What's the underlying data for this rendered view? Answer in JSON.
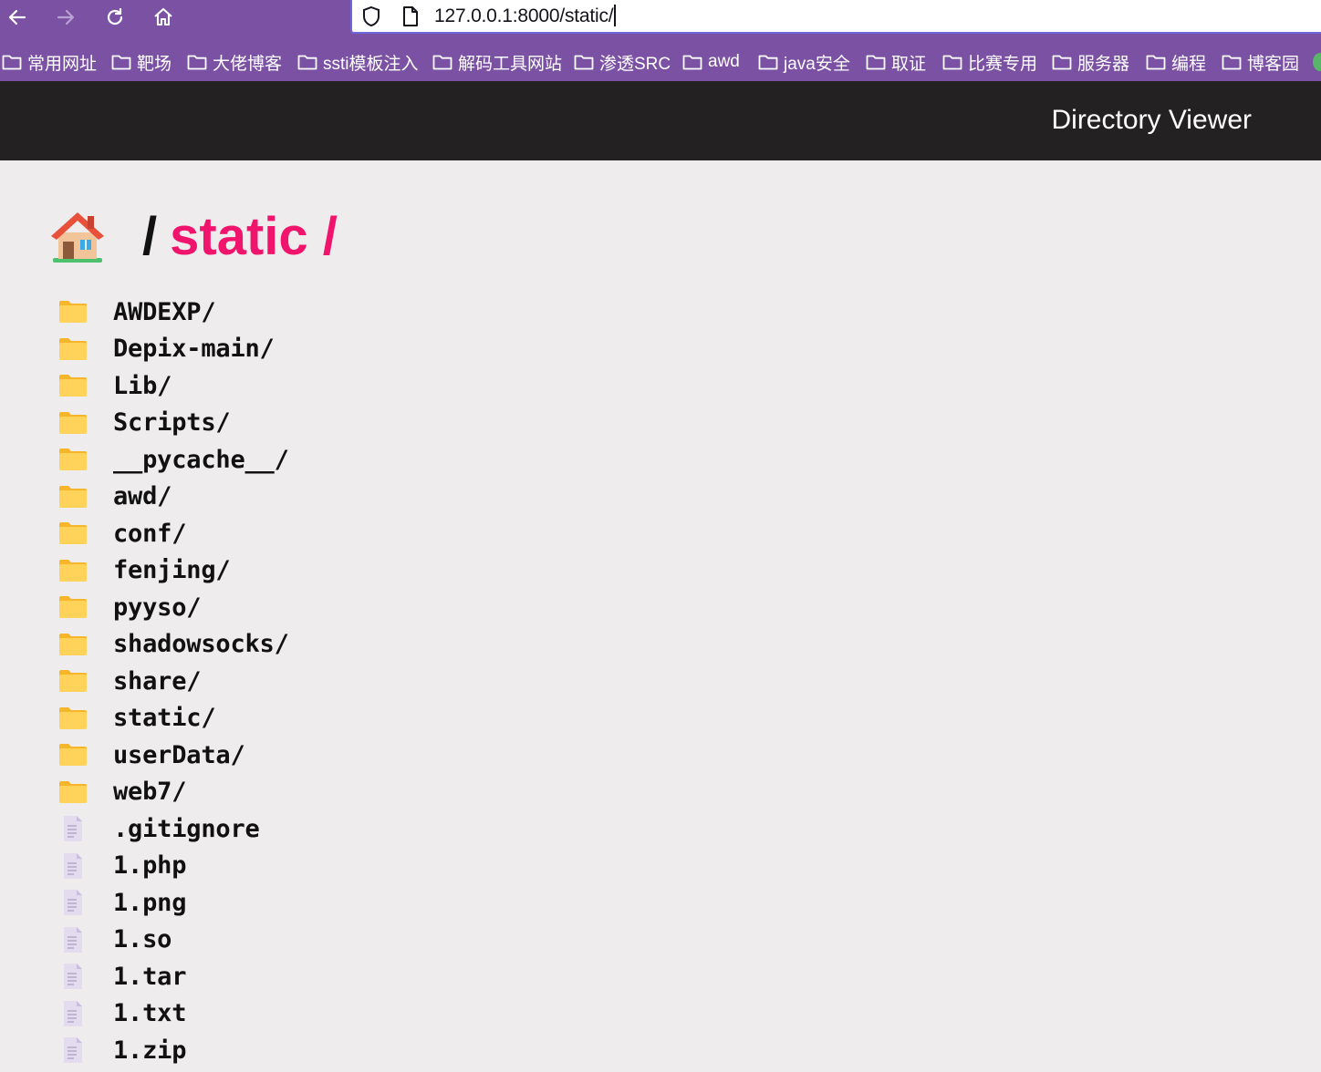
{
  "browser": {
    "url": "127.0.0.1:8000/static/",
    "nav": {
      "back_icon": "arrow-left-icon",
      "forward_icon": "arrow-right-icon",
      "reload_icon": "reload-icon",
      "home_icon": "home-icon"
    },
    "bookmarks": [
      "常用网址",
      "靶场",
      "大佬博客",
      "ssti模板注入",
      "解码工具网站",
      "渗透SRC",
      "awd",
      "java安全",
      "取证",
      "比赛专用",
      "服务器",
      "编程",
      "博客园"
    ],
    "colors": {
      "chrome": "#7b51a4",
      "url_focus": "#6f67d9"
    }
  },
  "site": {
    "title": "Directory Viewer",
    "colors": {
      "header": "#242122",
      "page": "#eeeced",
      "accent": "#f0146c"
    }
  },
  "breadcrumb": {
    "home_icon": "house-icon",
    "separator": "/",
    "current": "static /"
  },
  "entries": [
    {
      "name": "AWDEXP/",
      "type": "folder"
    },
    {
      "name": "Depix-main/",
      "type": "folder"
    },
    {
      "name": "Lib/",
      "type": "folder"
    },
    {
      "name": "Scripts/",
      "type": "folder"
    },
    {
      "name": "__pycache__/",
      "type": "folder"
    },
    {
      "name": "awd/",
      "type": "folder"
    },
    {
      "name": "conf/",
      "type": "folder"
    },
    {
      "name": "fenjing/",
      "type": "folder"
    },
    {
      "name": "pyyso/",
      "type": "folder"
    },
    {
      "name": "shadowsocks/",
      "type": "folder"
    },
    {
      "name": "share/",
      "type": "folder"
    },
    {
      "name": "static/",
      "type": "folder"
    },
    {
      "name": "userData/",
      "type": "folder"
    },
    {
      "name": "web7/",
      "type": "folder"
    },
    {
      "name": ".gitignore",
      "type": "file"
    },
    {
      "name": "1.php",
      "type": "file"
    },
    {
      "name": "1.png",
      "type": "file"
    },
    {
      "name": "1.so",
      "type": "file"
    },
    {
      "name": "1.tar",
      "type": "file"
    },
    {
      "name": "1.txt",
      "type": "file"
    },
    {
      "name": "1.zip",
      "type": "file"
    }
  ]
}
